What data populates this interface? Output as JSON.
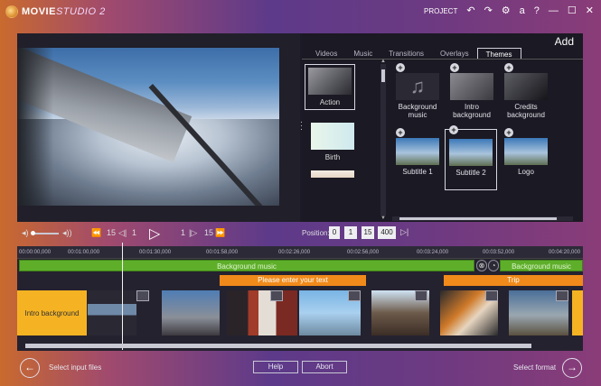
{
  "app": {
    "name_main": "MOVIE",
    "name_sub": "STUDIO 2"
  },
  "topbar": {
    "project_label": "PROJECT",
    "undo_icon": "undo-icon",
    "redo_icon": "redo-icon",
    "settings_icon": "gear-icon",
    "font_icon": "a",
    "help": "?",
    "minimize": "—",
    "maximize": "☐",
    "close": "✕"
  },
  "add_panel": {
    "title": "Add",
    "tabs": [
      "Videos",
      "Music",
      "Transitions",
      "Overlays",
      "Themes"
    ],
    "active_tab": "Themes",
    "themes": [
      "Action",
      "Birth"
    ],
    "selected_theme": "Action",
    "items": [
      {
        "label": "Background music",
        "type": "music"
      },
      {
        "label": "Intro background",
        "type": "thumb"
      },
      {
        "label": "Credits background",
        "type": "thumb"
      },
      {
        "label": "Subtitle 1",
        "type": "thumb"
      },
      {
        "label": "Subtitle 2",
        "type": "thumb",
        "selected": true
      },
      {
        "label": "Logo",
        "type": "thumb"
      }
    ]
  },
  "transport": {
    "back15": "15",
    "back1": "1",
    "fwd1": "1",
    "fwd15": "15",
    "position_label": "Position:",
    "position": [
      "0",
      "1",
      "15",
      "400"
    ]
  },
  "timeline": {
    "ticks": [
      "00:00:00,000",
      "00:01:00,000",
      "00:01:30,000",
      "00:01:58,000",
      "00:02:26,000",
      "00:02:56,000",
      "00:03:24,000",
      "00:03:52,000",
      "00:04:20,000"
    ],
    "music_tracks": [
      "Background music",
      "Background music"
    ],
    "text_tracks": [
      "Please enter your text",
      "Trip"
    ],
    "intro_clip": "Intro background"
  },
  "bottom": {
    "left_label": "Select input files",
    "help": "Help",
    "abort": "Abort",
    "right_label": "Select format"
  }
}
